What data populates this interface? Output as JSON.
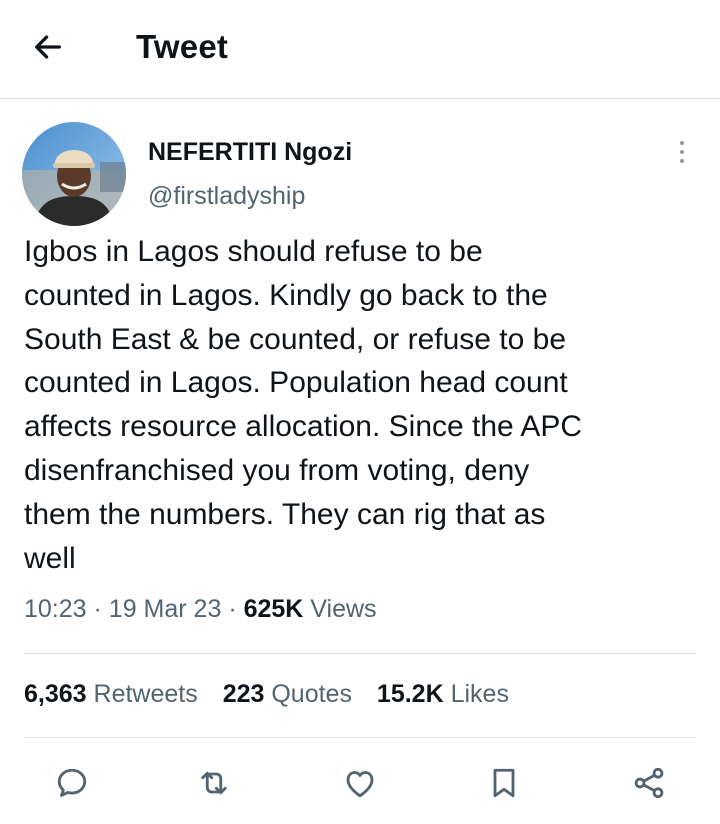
{
  "header": {
    "title": "Tweet",
    "back_icon": "arrow-left-icon"
  },
  "tweet": {
    "author": {
      "display_name": "NEFERTITI Ngozi",
      "handle": "@firstladyship"
    },
    "text": "Igbos in Lagos should refuse to be\ncounted in Lagos. Kindly go back to the\nSouth East & be counted, or refuse to be\ncounted in Lagos. Population head count\naffects resource allocation. Since the APC\ndisenfranchised you from voting, deny\nthem the numbers. They can rig that as\nwell",
    "time": "10:23",
    "date": "19 Mar 23",
    "separator": "·",
    "views_count": "625K",
    "views_label": "Views"
  },
  "stats": {
    "retweets_count": "6,363",
    "retweets_label": "Retweets",
    "quotes_count": "223",
    "quotes_label": "Quotes",
    "likes_count": "15.2K",
    "likes_label": "Likes"
  },
  "actions": [
    "reply-icon",
    "retweet-icon",
    "like-icon",
    "bookmark-icon",
    "share-icon"
  ],
  "colors": {
    "text_primary": "#0f1419",
    "text_secondary": "#536471",
    "divider": "#dfe3e6",
    "icon": "#536471"
  }
}
